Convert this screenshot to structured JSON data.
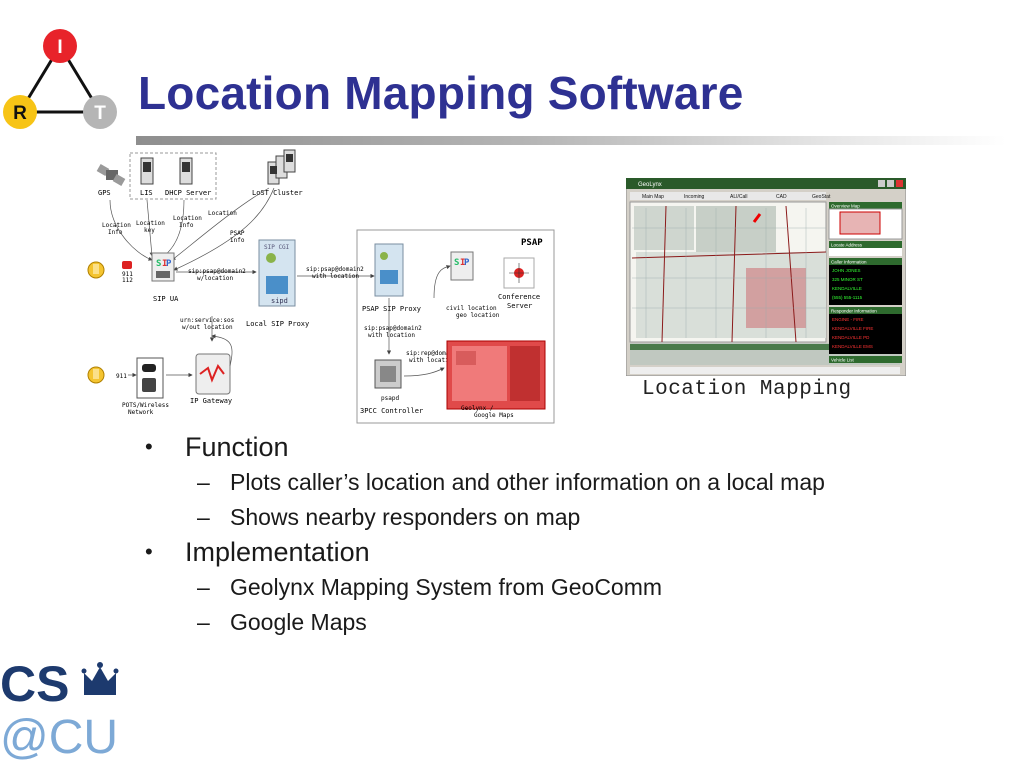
{
  "slide": {
    "title": "Location Mapping Software"
  },
  "logo_irt": {
    "letters": [
      "I",
      "R",
      "T"
    ],
    "colors": {
      "I": "#e8232a",
      "R": "#f7c416",
      "T": "#b5b5b5"
    }
  },
  "diagram": {
    "nodes": {
      "gps": "GPS",
      "lis": "LIS",
      "dhcp": "DHCP Server",
      "lost": "LoST Cluster",
      "sip_ua": "SIP UA",
      "local_proxy": "Local SIP Proxy",
      "sipd_small": "SIP CGI",
      "sipd": "sipd",
      "psap": "PSAP",
      "psap_proxy": "PSAP SIP Proxy",
      "conference": [
        "Conference",
        "Server"
      ],
      "psapd": "psapd",
      "controller": "3PCC Controller",
      "geolynx_maps": [
        "Geolynx /",
        "Google Maps"
      ],
      "ip_gateway": "IP Gateway",
      "pots": [
        "POTS/Wireless",
        "Network"
      ]
    },
    "labels": {
      "location_info_1": [
        "Location",
        "Info"
      ],
      "location_key": [
        "Location",
        "key"
      ],
      "location_info_2": [
        "Location",
        "Info"
      ],
      "location": "Location",
      "psap_info": [
        "PSAP",
        "Info"
      ],
      "n911_1": "911",
      "n112": "112",
      "uri_psap": [
        "sip:psap@domain2",
        "w/location"
      ],
      "uri_psap_with": [
        "sip:psap@domain2",
        "with location"
      ],
      "urn_sos": [
        "urn:service:sos",
        "w/out location"
      ],
      "uri_psap_3": [
        "sip:psap@domain2",
        "with location"
      ],
      "civil_geo": [
        "civil location",
        "geo location"
      ],
      "uri_rep": [
        "sip:rep@domain2",
        "with location"
      ],
      "n911_2": "911"
    }
  },
  "screenshot": {
    "window_title": "GeoLynx",
    "tabs": [
      "Main Map",
      "Incoming",
      "ALI/Call",
      "CAD",
      "GeoStat"
    ],
    "panels": {
      "overview": "Overview Map",
      "locate": "Locate Address",
      "caller": "Caller Information",
      "responder": "Responder Information",
      "vehicle": "Vehicle List"
    },
    "caller_lines": [
      "JOHN JONES",
      "325 MINOR ST",
      "KENDALVILLE",
      "(555) 555-1115"
    ],
    "responder_lines": [
      "ENGINE - FIRE",
      "KENDALVILLE FIRE",
      "KENDALVILLE PD",
      "KENDALVILLE EMS"
    ],
    "caption": "Location Mapping"
  },
  "bullets": [
    {
      "text": "Function",
      "sub": [
        "Plots caller’s location and other information on a local map",
        "Shows nearby responders on map"
      ]
    },
    {
      "text": "Implementation",
      "sub": [
        "Geolynx Mapping System from GeoComm",
        "Google Maps"
      ]
    }
  ],
  "bullet_symbol": "•",
  "sub_bullet_symbol": "–",
  "logo_cs": {
    "top": "CS",
    "bottom": "@CU",
    "color": "#1d3a6e",
    "accent": "#7da9d6"
  }
}
